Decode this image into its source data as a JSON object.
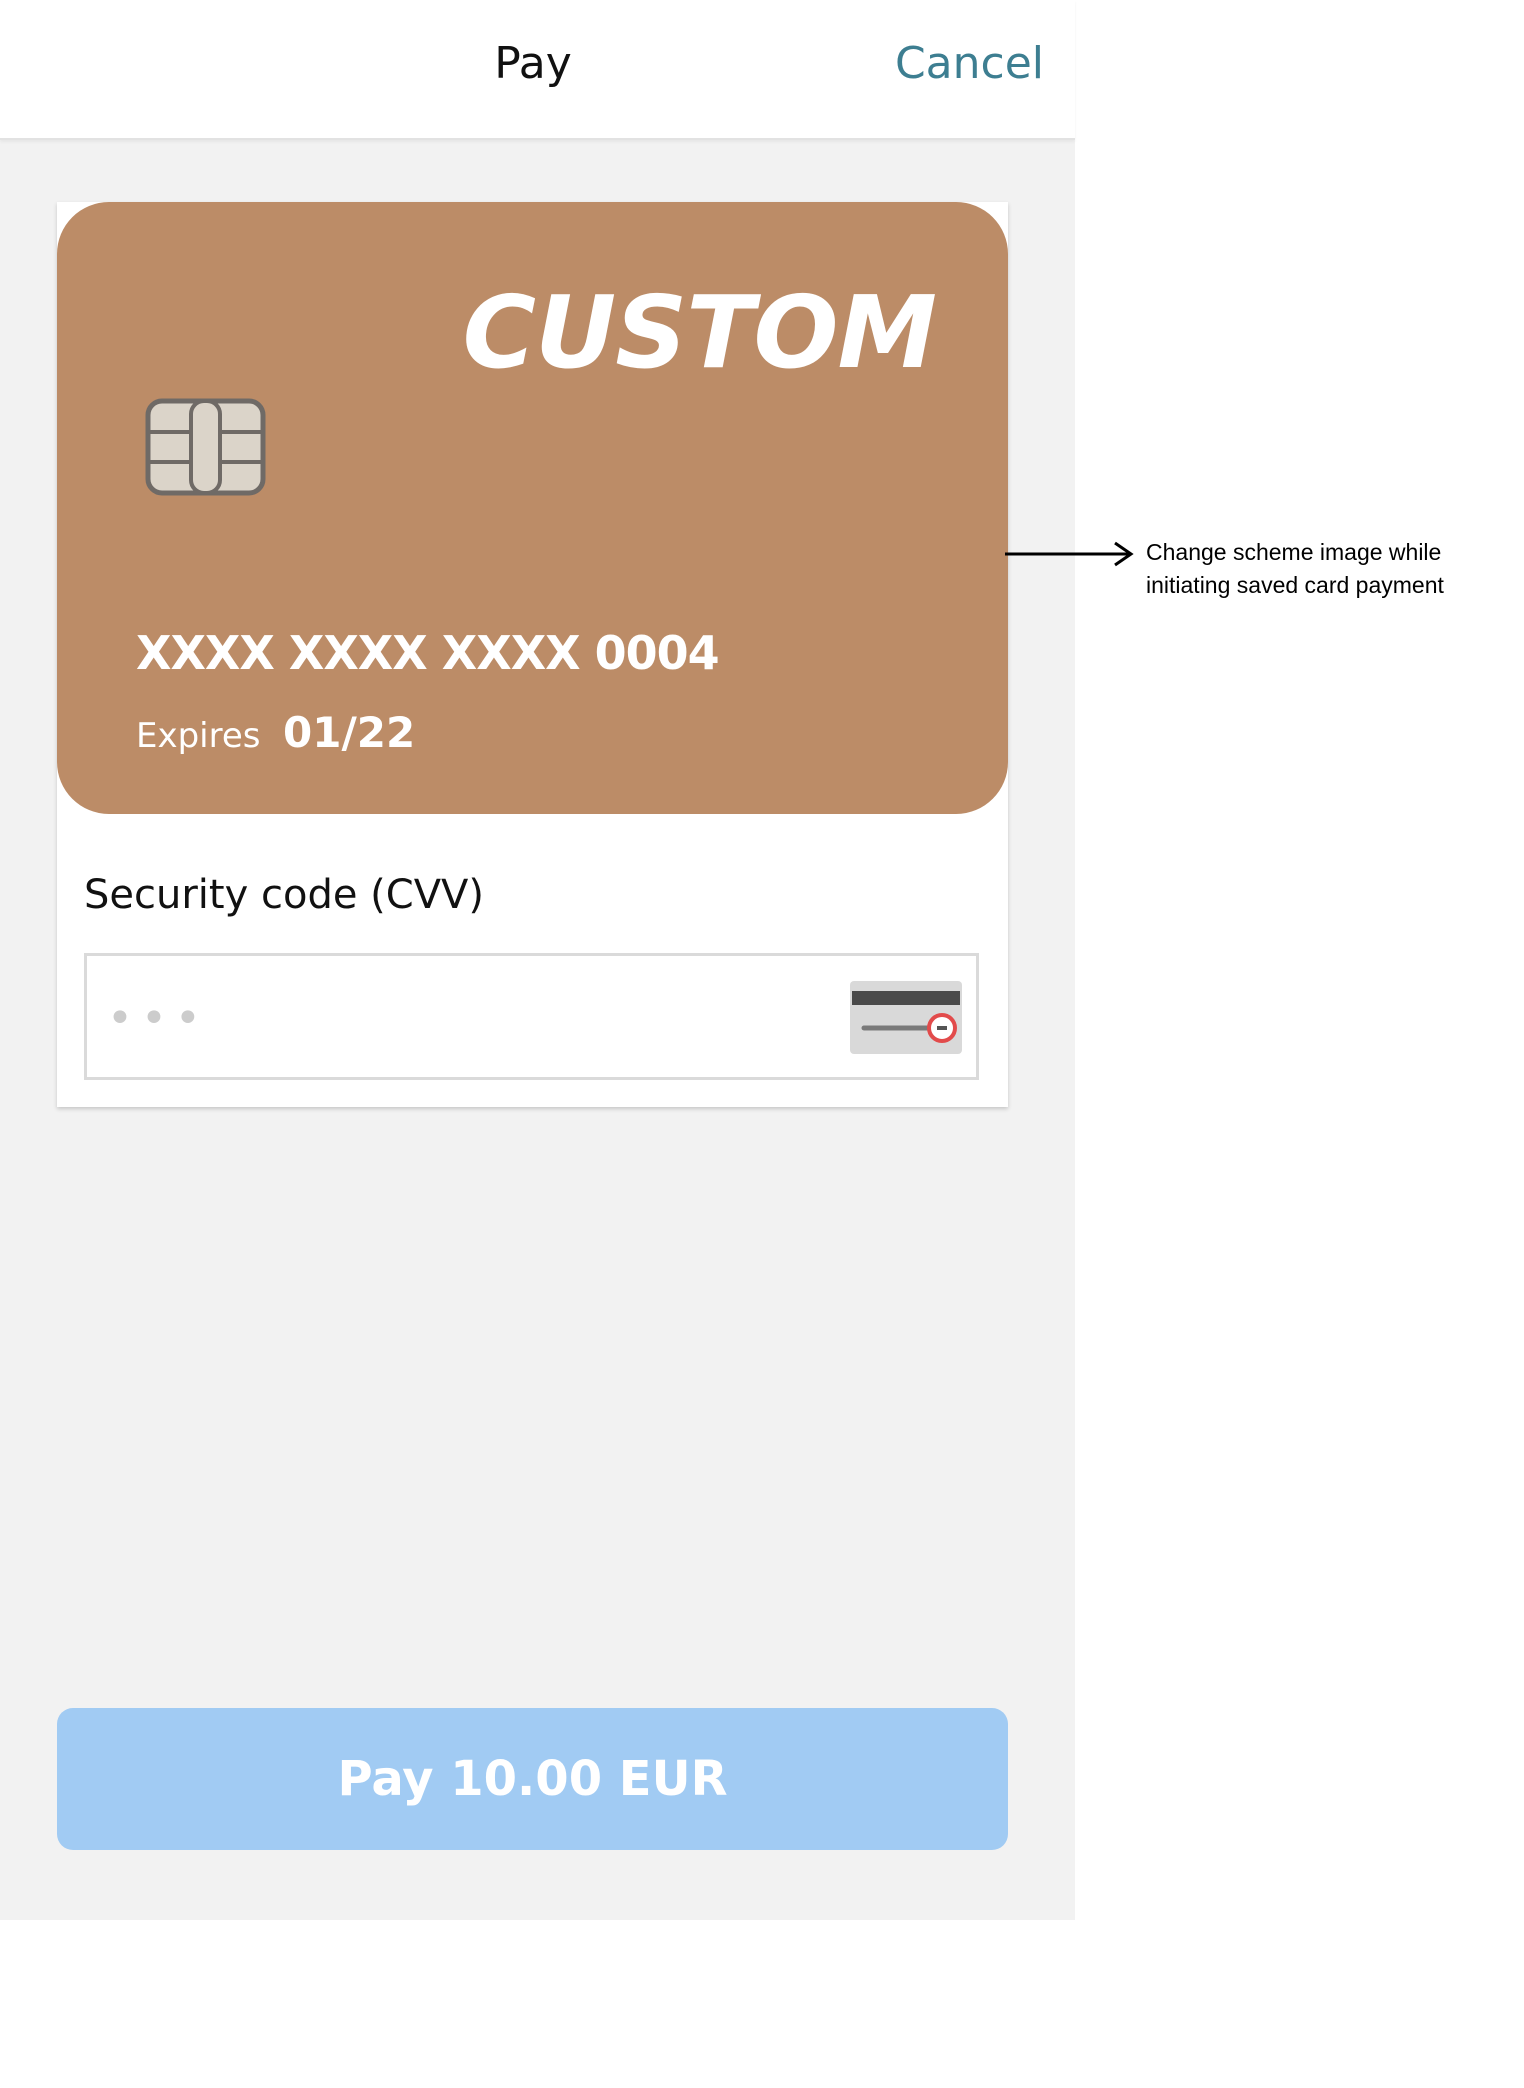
{
  "header": {
    "title": "Pay",
    "cancel_label": "Cancel"
  },
  "card": {
    "brand": "CUSTOM",
    "number": "XXXX XXXX XXXX 0004",
    "expires_label": "Expires",
    "expires_value": "01/22",
    "color": "#bc8c67",
    "chip_icon": "card-chip-icon"
  },
  "cvv": {
    "label": "Security code (CVV)",
    "placeholder": "•••",
    "value": "",
    "icon": "card-back-cvv-icon"
  },
  "pay_button": {
    "label": "Pay 10.00 EUR",
    "color": "#a1cbf3"
  },
  "annotation": {
    "text": "Change scheme image while initiating saved card payment",
    "icon": "arrow-right-icon"
  },
  "colors": {
    "accent": "#3d7e91",
    "background": "#f2f2f2"
  }
}
